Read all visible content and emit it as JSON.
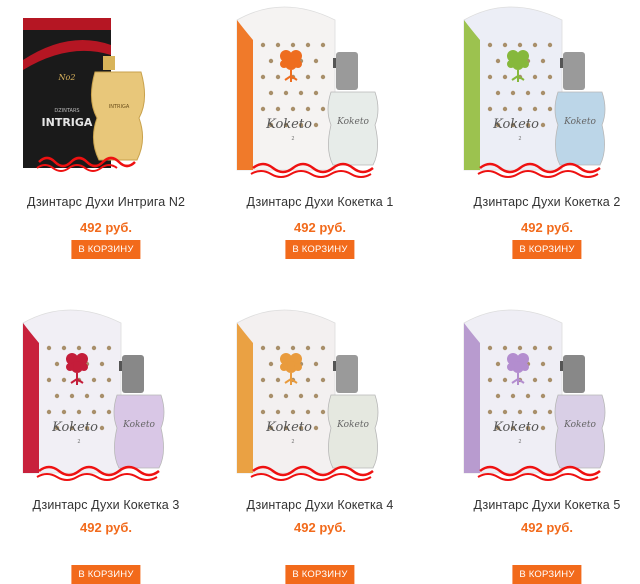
{
  "products": [
    {
      "name": "Дзинтарс Духи Интрига N2",
      "price": "492 руб.",
      "button": "В КОРЗИНУ",
      "box_color": "#1a1a1a",
      "accent": "#b51623",
      "flower_color": "#b51623",
      "box_brand": "INTRIGA",
      "box_sub": "DZINTARS",
      "box_no": "No2",
      "bottle_color": "#e8c77a",
      "cap_color": "#d8b45a"
    },
    {
      "name": "Дзинтарс Духи Кокетка 1",
      "price": "492 руб.",
      "button": "В КОРЗИНУ",
      "box_color": "#f5f3f2",
      "accent": "#f07a2a",
      "flower_color": "#ee6d1f",
      "box_script": "Koketo",
      "bottle_color": "#e7ece9",
      "cap_color": "#9a9a9a"
    },
    {
      "name": "Дзинтарс Духи Кокетка 2",
      "price": "492 руб.",
      "button": "В КОРЗИНУ",
      "box_color": "#eceef6",
      "accent": "#9cc24f",
      "flower_color": "#86b83c",
      "box_script": "Koketo",
      "bottle_color": "#bcd6e8",
      "cap_color": "#9a9a9a"
    },
    {
      "name": "Дзинтарс Духи Кокетка 3",
      "price": "492 руб.",
      "button": "В КОРЗИНУ",
      "box_color": "#f1eff5",
      "accent": "#c8213c",
      "flower_color": "#c41d3a",
      "box_script": "Koketo",
      "bottle_color": "#d9c7e6",
      "cap_color": "#888888"
    },
    {
      "name": "Дзинтарс Духи Кокетка 4",
      "price": "492 руб.",
      "button": "В КОРЗИНУ",
      "box_color": "#f3f0f0",
      "accent": "#eaa143",
      "flower_color": "#e99b3d",
      "box_script": "Koketo",
      "bottle_color": "#e5e8e0",
      "cap_color": "#9a9a9a"
    },
    {
      "name": "Дзинтарс Духи Кокетка 5",
      "price": "492 руб.",
      "button": "В КОРЗИНУ",
      "box_color": "#efeef5",
      "accent": "#b89bcf",
      "flower_color": "#b38dcf",
      "box_script": "Koketo",
      "bottle_color": "#d9cfe6",
      "cap_color": "#888888"
    }
  ]
}
